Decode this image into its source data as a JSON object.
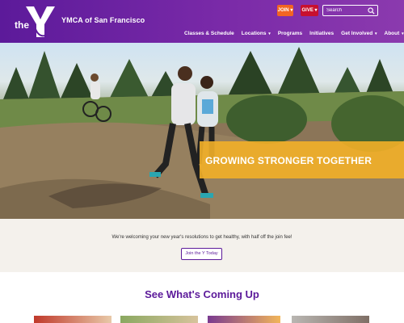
{
  "header": {
    "logo_the": "the",
    "org_name": "YMCA of San Francisco",
    "join_label": "JOIN",
    "give_label": "GIVE",
    "search_placeholder": "Search"
  },
  "nav": {
    "items": [
      {
        "label": "Classes & Schedule"
      },
      {
        "label": "Locations"
      },
      {
        "label": "Programs"
      },
      {
        "label": "Initiatives"
      },
      {
        "label": "Get Involved"
      },
      {
        "label": "About"
      }
    ],
    "chevron": "▾"
  },
  "hero": {
    "title": "GROWING STRONGER TOGETHER"
  },
  "promo": {
    "text": "We're welcoming your new year's resolutions to get healthy, with half off the join fee!",
    "button_label": "Join the Y Today"
  },
  "coming_up": {
    "title": "See What's Coming Up"
  },
  "colors": {
    "brand_purple": "#5c1a9a",
    "join_orange": "#f26522",
    "give_red": "#c8102e",
    "banner_gold": "#f2af28"
  }
}
